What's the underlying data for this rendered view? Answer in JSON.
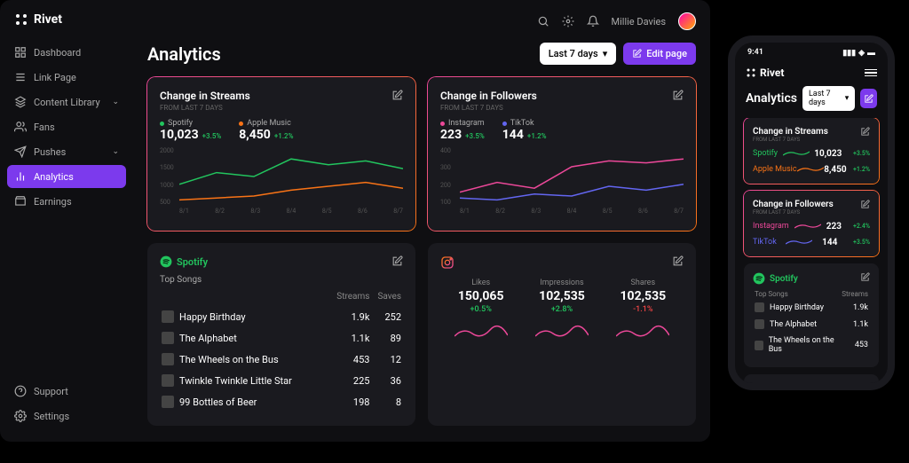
{
  "brand": "Rivet",
  "user": {
    "name": "Millie Davies"
  },
  "nav": {
    "items": [
      {
        "label": "Dashboard",
        "icon": "grid"
      },
      {
        "label": "Link Page",
        "icon": "link"
      },
      {
        "label": "Content Library",
        "icon": "layers",
        "expandable": true
      },
      {
        "label": "Fans",
        "icon": "users"
      },
      {
        "label": "Pushes",
        "icon": "send",
        "expandable": true
      },
      {
        "label": "Analytics",
        "icon": "chart",
        "active": true
      },
      {
        "label": "Earnings",
        "icon": "wallet"
      }
    ],
    "bottom": [
      {
        "label": "Support",
        "icon": "help"
      },
      {
        "label": "Settings",
        "icon": "gear"
      }
    ]
  },
  "page": {
    "title": "Analytics",
    "range_label": "Last 7 days",
    "edit_label": "Edit page"
  },
  "streams_card": {
    "title": "Change in Streams",
    "sub": "From last 7 days",
    "metrics": [
      {
        "label": "Spotify",
        "value": "10,023",
        "delta": "+3.5%",
        "color": "green"
      },
      {
        "label": "Apple Music",
        "value": "8,450",
        "delta": "+1.2%",
        "color": "orange"
      }
    ]
  },
  "followers_card": {
    "title": "Change in Followers",
    "sub": "From last 7 days",
    "metrics": [
      {
        "label": "Instagram",
        "value": "223",
        "delta": "+3.5%",
        "color": "pink"
      },
      {
        "label": "TikTok",
        "value": "144",
        "delta": "+1.2%",
        "color": "blue"
      }
    ]
  },
  "spotify_card": {
    "brand": "Spotify",
    "section": "Top Songs",
    "cols": [
      "",
      "Streams",
      "Saves"
    ],
    "rows": [
      {
        "title": "Happy Birthday",
        "streams": "1.9k",
        "saves": "252"
      },
      {
        "title": "The Alphabet",
        "streams": "1.1k",
        "saves": "89"
      },
      {
        "title": "The Wheels on the Bus",
        "streams": "453",
        "saves": "12"
      },
      {
        "title": "Twinkle Twinkle Little Star",
        "streams": "225",
        "saves": "36"
      },
      {
        "title": "99 Bottles of Beer",
        "streams": "198",
        "saves": "8"
      }
    ]
  },
  "instagram_card": {
    "stats": [
      {
        "label": "Likes",
        "value": "150,065",
        "delta": "+0.5%",
        "dir": "pos"
      },
      {
        "label": "Impressions",
        "value": "102,535",
        "delta": "+2.8%",
        "dir": "pos"
      },
      {
        "label": "Shares",
        "value": "102,535",
        "delta": "-1.1%",
        "dir": "neg"
      }
    ]
  },
  "mobile": {
    "time": "9:41",
    "followers_deltas": {
      "instagram": "+2.4%",
      "tiktok": "+3.5%"
    },
    "spotify_rows": [
      {
        "title": "Happy Birthday",
        "streams": "1.9k"
      },
      {
        "title": "The Alphabet",
        "streams": "1.1k"
      },
      {
        "title": "The Wheels on the Bus",
        "streams": "453"
      }
    ],
    "streams_col": "Streams"
  },
  "chart_data": [
    {
      "id": "streams",
      "type": "line",
      "title": "Change in Streams",
      "ylabel": "",
      "xlabel": "",
      "categories": [
        "8/1",
        "8/2",
        "8/3",
        "8/4",
        "8/5",
        "8/6",
        "8/7"
      ],
      "yticks": [
        500,
        1000,
        1500,
        2000
      ],
      "series": [
        {
          "name": "Spotify",
          "color": "#22c55e",
          "values": [
            1050,
            1350,
            1250,
            1700,
            1550,
            1650,
            1450
          ]
        },
        {
          "name": "Apple Music",
          "color": "#f97316",
          "values": [
            650,
            700,
            750,
            900,
            1000,
            1100,
            950
          ]
        }
      ]
    },
    {
      "id": "followers",
      "type": "line",
      "title": "Change in Followers",
      "ylabel": "",
      "xlabel": "",
      "categories": [
        "8/1",
        "8/2",
        "8/3",
        "8/4",
        "8/5",
        "8/6",
        "8/7"
      ],
      "yticks": [
        100,
        200,
        300,
        400
      ],
      "series": [
        {
          "name": "Instagram",
          "color": "#ec4899",
          "values": [
            170,
            220,
            190,
            300,
            330,
            320,
            340
          ]
        },
        {
          "name": "TikTok",
          "color": "#6366f1",
          "values": [
            140,
            130,
            160,
            150,
            200,
            180,
            210
          ]
        }
      ]
    }
  ]
}
